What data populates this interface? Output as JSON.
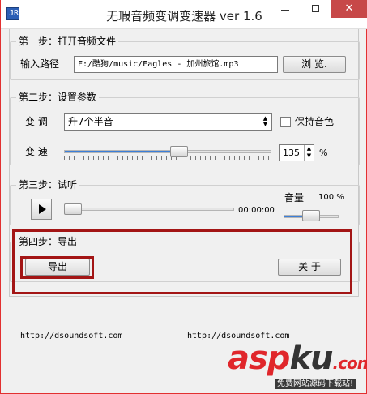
{
  "window": {
    "title": "无瑕音频变调变速器 ver 1.6",
    "icon_label": "JR",
    "close_glyph": "✕"
  },
  "step1": {
    "title": "第一步：打开音频文件",
    "path_label": "输入路径",
    "path_value": "F:/酷狗/music/Eagles - 加州旅馆.mp3",
    "browse_label": "浏  览."
  },
  "step2": {
    "title": "第二步：设置参数",
    "pitch_label": "变 调",
    "pitch_selected": "升7个半音",
    "keep_tone_label": "保持音色",
    "speed_label": "变 速",
    "speed_fraction": 0.56,
    "speed_value": "135",
    "speed_unit": "%"
  },
  "step3": {
    "title": "第三步：试听",
    "time": "00:00:00",
    "volume_label": "音量",
    "volume_value": "100 %",
    "progress_fraction": 0.0,
    "volume_fraction": 0.5
  },
  "step4": {
    "title": "第四步：导出",
    "export_label": "导出",
    "about_label": "关  于"
  },
  "footer": {
    "url_left": "http://dsoundsoft.com",
    "url_right": "http://dsoundsoft.com"
  },
  "watermark": {
    "text_red": "asp",
    "text_dark": "ku",
    "text_end": ".com",
    "subtitle": "免费网站源码下载站!",
    "colors": {
      "red": "#e0262b",
      "dark": "#333333"
    }
  },
  "colors": {
    "accent_blue": "#3c7fd8",
    "highlight_red": "#a31515",
    "close_red": "#c74848"
  }
}
